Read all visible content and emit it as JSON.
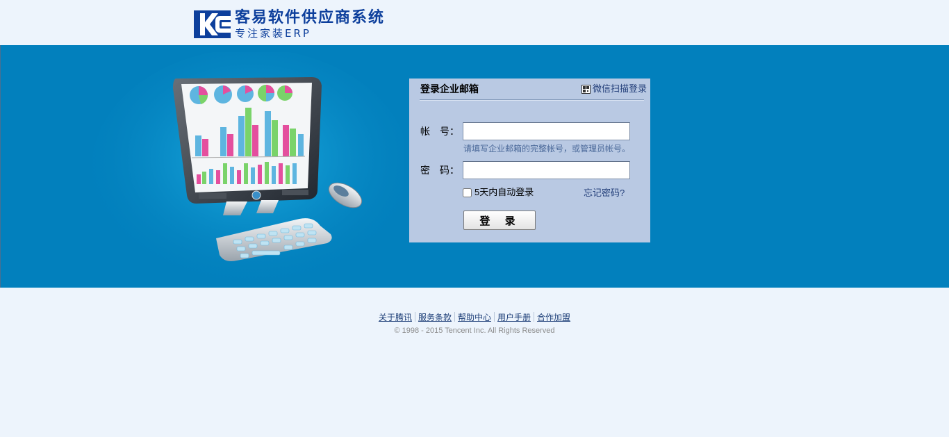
{
  "header": {
    "logo_title": "客易软件供应商系统",
    "logo_subtitle": "专注家装ERP",
    "brand_color": "#0d3f9c"
  },
  "banner": {
    "background_color": "#0280bd"
  },
  "login": {
    "title": "登录企业邮箱",
    "qr_login_label": "微信扫描登录",
    "account_label": "帐　号：",
    "account_value": "",
    "account_hint": "请填写企业邮箱的完整帐号，或管理员帐号。",
    "password_label": "密　码：",
    "password_value": "",
    "remember_label": "5天内自动登录",
    "remember_checked": false,
    "forgot_label": "忘记密码?",
    "submit_label": "登 录",
    "panel_color": "#b9c9e3"
  },
  "footer": {
    "links": [
      {
        "label": "关于腾讯"
      },
      {
        "label": "服务条款"
      },
      {
        "label": "帮助中心"
      },
      {
        "label": "用户手册"
      },
      {
        "label": "合作加盟"
      }
    ],
    "copyright": "© 1998 - 2015 Tencent Inc. All Rights Reserved"
  }
}
